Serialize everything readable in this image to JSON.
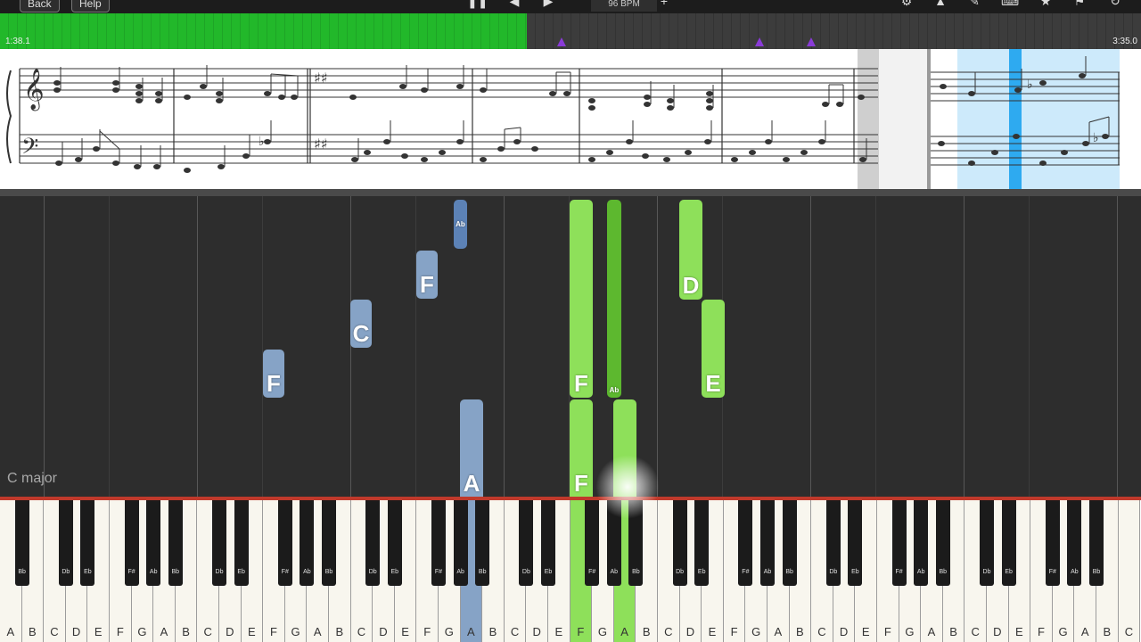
{
  "toolbar": {
    "back_label": "Back",
    "help_label": "Help",
    "pause_icon": "pause-icon",
    "prev_icon": "skip-back-icon",
    "next_icon": "skip-forward-icon",
    "bpm": "96 BPM",
    "add_icon": "plus-icon",
    "right_icons": [
      "gear-icon",
      "metronome-icon",
      "pencil-icon",
      "keyboard-icon",
      "star-icon",
      "bookmark-icon",
      "loop-icon"
    ]
  },
  "timeline": {
    "current_time": "1:38.1",
    "total_time": "3:35.0",
    "progress": 0.462,
    "played_color": "#22b82a",
    "marker_color": "#8a3bd8",
    "marker_positions": [
      0.492,
      0.666,
      0.711
    ]
  },
  "roll": {
    "key_signature_label": "C major",
    "notes": [
      {
        "label": "F",
        "color": "#86a3c6"
      },
      {
        "label": "C",
        "color": "#86a3c6"
      },
      {
        "label": "F",
        "color": "#86a3c6"
      },
      {
        "label": "Ab",
        "color": "#5c82b6"
      },
      {
        "label": "A",
        "color": "#86a3c6"
      },
      {
        "label": "F",
        "color": "#8ee05a"
      },
      {
        "label": "Ab",
        "color": "#5db82f"
      },
      {
        "label": "F",
        "color": "#8ee05a"
      },
      {
        "label": "",
        "color": "#8ee05a"
      },
      {
        "label": "D",
        "color": "#8ee05a"
      },
      {
        "label": "E",
        "color": "#8ee05a"
      }
    ]
  },
  "keyboard": {
    "white_labels": [
      "A",
      "B",
      "C",
      "D",
      "E",
      "F",
      "G",
      "A",
      "B",
      "C",
      "D",
      "E",
      "F",
      "G",
      "A",
      "B",
      "C",
      "D",
      "E",
      "F",
      "G",
      "A",
      "B",
      "C",
      "D",
      "E",
      "F",
      "G",
      "A",
      "B",
      "C",
      "D",
      "E",
      "F",
      "G",
      "A",
      "B",
      "C",
      "D",
      "E",
      "F",
      "G",
      "A",
      "B",
      "C",
      "D",
      "E",
      "F",
      "G",
      "A",
      "B",
      "C"
    ],
    "black_labels": [
      "Bb",
      "Db",
      "Eb",
      "F#",
      "Ab",
      "Bb",
      "Db",
      "Eb",
      "F#",
      "Ab",
      "Bb",
      "Db",
      "Eb",
      "F#",
      "Ab",
      "Bb",
      "Db",
      "Eb",
      "F#",
      "Ab",
      "Bb",
      "Db",
      "Eb",
      "F#",
      "Ab",
      "Bb",
      "Db",
      "Eb",
      "F#",
      "Ab",
      "Bb",
      "Db",
      "Eb",
      "F#",
      "Ab",
      "Bb"
    ],
    "highlighted": {
      "blue": "A",
      "green": [
        "F",
        "A"
      ]
    }
  }
}
